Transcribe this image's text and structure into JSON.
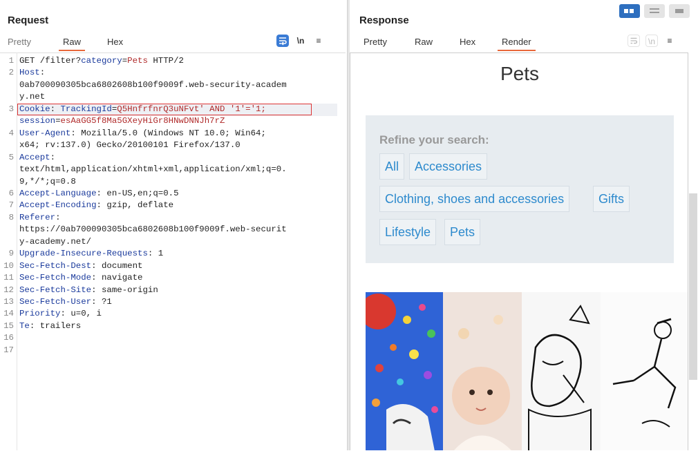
{
  "request": {
    "title": "Request",
    "tabs": [
      "Pretty",
      "Raw",
      "Hex"
    ],
    "active_tab": "Raw",
    "tools": {
      "wrap": "wrap-lines-icon",
      "newline": "\\n",
      "menu": "≡"
    },
    "lines": [
      {
        "n": "1",
        "parts": [
          {
            "t": "GET /filter?"
          },
          {
            "t": "category",
            "c": "k"
          },
          {
            "t": "="
          },
          {
            "t": "Pets",
            "c": "v"
          },
          {
            "t": " HTTP/2"
          }
        ]
      },
      {
        "n": "2",
        "parts": [
          {
            "t": "Host",
            "c": "k"
          },
          {
            "t": ":"
          }
        ]
      },
      {
        "n": "",
        "parts": [
          {
            "t": "0ab700090305bca6802608b100f9009f.web-security-academ"
          }
        ]
      },
      {
        "n": "",
        "parts": [
          {
            "t": "y.net"
          }
        ]
      },
      {
        "n": "3",
        "parts": [
          {
            "t": "Cookie",
            "c": "k"
          },
          {
            "t": ": "
          },
          {
            "t": "TrackingId",
            "c": "k"
          },
          {
            "t": "="
          },
          {
            "t": "Q5HnfrfnrQ3uNFvt' AND '1'='1;",
            "c": "v"
          }
        ]
      },
      {
        "n": "",
        "parts": [
          {
            "t": "session",
            "c": "k"
          },
          {
            "t": "="
          },
          {
            "t": "esAaGG5f8Ma5GXeyHiGr8HNwDNNJh7rZ",
            "c": "v"
          }
        ]
      },
      {
        "n": "4",
        "parts": [
          {
            "t": "User-Agent",
            "c": "k"
          },
          {
            "t": ": Mozilla/5.0 (Windows NT 10.0; Win64;"
          }
        ]
      },
      {
        "n": "",
        "parts": [
          {
            "t": "x64; rv:137.0) Gecko/20100101 Firefox/137.0"
          }
        ]
      },
      {
        "n": "5",
        "parts": [
          {
            "t": "Accept",
            "c": "k"
          },
          {
            "t": ":"
          }
        ]
      },
      {
        "n": "",
        "parts": [
          {
            "t": "text/html,application/xhtml+xml,application/xml;q=0."
          }
        ]
      },
      {
        "n": "",
        "parts": [
          {
            "t": "9,*/*;q=0.8"
          }
        ]
      },
      {
        "n": "6",
        "parts": [
          {
            "t": "Accept-Language",
            "c": "k"
          },
          {
            "t": ": en-US,en;q=0.5"
          }
        ]
      },
      {
        "n": "7",
        "parts": [
          {
            "t": "Accept-Encoding",
            "c": "k"
          },
          {
            "t": ": gzip, deflate"
          }
        ]
      },
      {
        "n": "8",
        "parts": [
          {
            "t": "Referer",
            "c": "k"
          },
          {
            "t": ":"
          }
        ]
      },
      {
        "n": "",
        "parts": [
          {
            "t": "https://0ab700090305bca6802608b100f9009f.web-securit"
          }
        ]
      },
      {
        "n": "",
        "parts": [
          {
            "t": "y-academy.net/"
          }
        ]
      },
      {
        "n": "9",
        "parts": [
          {
            "t": "Upgrade-Insecure-Requests",
            "c": "k"
          },
          {
            "t": ": 1"
          }
        ]
      },
      {
        "n": "10",
        "parts": [
          {
            "t": "Sec-Fetch-Dest",
            "c": "k"
          },
          {
            "t": ": document"
          }
        ]
      },
      {
        "n": "11",
        "parts": [
          {
            "t": "Sec-Fetch-Mode",
            "c": "k"
          },
          {
            "t": ": navigate"
          }
        ]
      },
      {
        "n": "12",
        "parts": [
          {
            "t": "Sec-Fetch-Site",
            "c": "k"
          },
          {
            "t": ": same-origin"
          }
        ]
      },
      {
        "n": "13",
        "parts": [
          {
            "t": "Sec-Fetch-User",
            "c": "k"
          },
          {
            "t": ": ?1"
          }
        ]
      },
      {
        "n": "14",
        "parts": [
          {
            "t": "Priority",
            "c": "k"
          },
          {
            "t": ": u=0, i"
          }
        ]
      },
      {
        "n": "15",
        "parts": [
          {
            "t": "Te",
            "c": "k"
          },
          {
            "t": ": trailers"
          }
        ]
      },
      {
        "n": "16",
        "parts": []
      },
      {
        "n": "17",
        "parts": []
      }
    ]
  },
  "response": {
    "title": "Response",
    "tabs": [
      "Pretty",
      "Raw",
      "Hex",
      "Render"
    ],
    "active_tab": "Render",
    "tools": {
      "wrap": "wrap-lines-icon",
      "newline": "\\n",
      "menu": "≡"
    },
    "render": {
      "page_title": "Pets",
      "refine_label": "Refine your search:",
      "categories": [
        "All",
        "Accessories",
        "Clothing, shoes and accessories",
        "Gifts",
        "Lifestyle",
        "Pets"
      ]
    }
  },
  "layout_buttons": [
    "layout-side-by-side-icon",
    "layout-horizontal-icon",
    "layout-single-icon"
  ],
  "colors": {
    "accent": "#e8683a",
    "key": "#1a3a9c",
    "value": "#b02a2a",
    "link": "#2d8acd",
    "highlight": "#dd3333"
  }
}
